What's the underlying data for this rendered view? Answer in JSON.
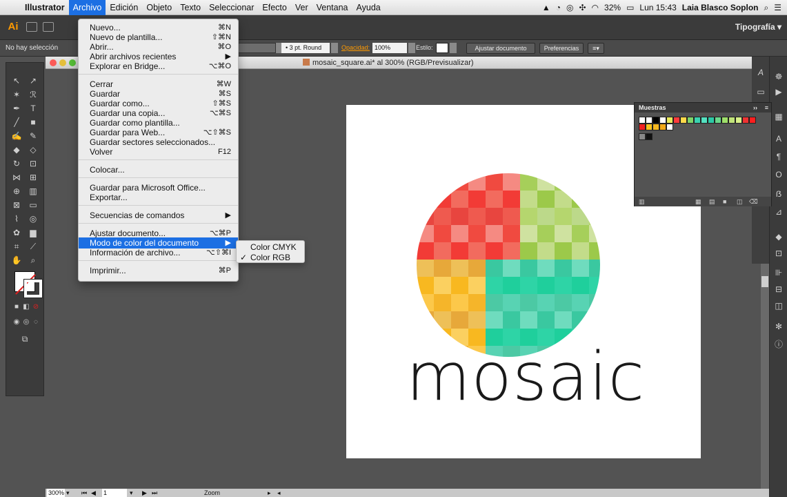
{
  "menubar": {
    "app_name": "Illustrator",
    "items": [
      "Archivo",
      "Edición",
      "Objeto",
      "Texto",
      "Seleccionar",
      "Efecto",
      "Ver",
      "Ventana",
      "Ayuda"
    ],
    "battery": "32%",
    "clock": "Lun 15:43",
    "user": "Laia Blasco Soplon"
  },
  "appbar": {
    "workspace": "Tipografía",
    "logo": "Ai"
  },
  "controlbar": {
    "selection_status": "No hay selección",
    "stroke_profile": "3 pt. Round",
    "opacity_label": "Opacidad:",
    "opacity_value": "100%",
    "style_label": "Estilo:",
    "btn_document_setup": "Ajustar documento",
    "btn_preferences": "Preferencias"
  },
  "document": {
    "title": "mosaic_square.ai* al 300% (RGB/Previsualizar)",
    "artwork_word": "mosaic",
    "zoom": "300%",
    "page": "1",
    "status_label": "Zoom"
  },
  "file_menu": {
    "items": [
      {
        "label": "Nuevo...",
        "shortcut": "⌘N"
      },
      {
        "label": "Nuevo de plantilla...",
        "shortcut": "⇧⌘N"
      },
      {
        "label": "Abrir...",
        "shortcut": "⌘O"
      },
      {
        "label": "Abrir archivos recientes",
        "shortcut": "▶"
      },
      {
        "label": "Explorar en Bridge...",
        "shortcut": "⌥⌘O"
      },
      {
        "label": "Cerrar",
        "shortcut": "⌘W"
      },
      {
        "label": "Guardar",
        "shortcut": "⌘S"
      },
      {
        "label": "Guardar como...",
        "shortcut": "⇧⌘S"
      },
      {
        "label": "Guardar una copia...",
        "shortcut": "⌥⌘S"
      },
      {
        "label": "Guardar como plantilla...",
        "shortcut": ""
      },
      {
        "label": "Guardar para Web...",
        "shortcut": "⌥⇧⌘S"
      },
      {
        "label": "Guardar sectores seleccionados...",
        "shortcut": ""
      },
      {
        "label": "Volver",
        "shortcut": "F12"
      },
      {
        "label": "Colocar...",
        "shortcut": ""
      },
      {
        "label": "Guardar para Microsoft Office...",
        "shortcut": ""
      },
      {
        "label": "Exportar...",
        "shortcut": ""
      },
      {
        "label": "Secuencias de comandos",
        "shortcut": "▶"
      },
      {
        "label": "Ajustar documento...",
        "shortcut": "⌥⌘P"
      },
      {
        "label": "Modo de color del documento",
        "shortcut": "▶"
      },
      {
        "label": "Información de archivo...",
        "shortcut": "⌥⇧⌘I"
      },
      {
        "label": "Imprimir...",
        "shortcut": "⌘P"
      }
    ]
  },
  "color_mode_submenu": {
    "items": [
      {
        "label": "Color CMYK",
        "checked": false
      },
      {
        "label": "Color RGB",
        "checked": true
      }
    ],
    "check_glyph": "✓"
  },
  "swatches_panel": {
    "title": "Muestras"
  },
  "colors": {
    "accent": "#1c6fe3",
    "ai_orange": "#ff9a00",
    "mosaic_red": "#f04a40",
    "mosaic_green": "#a6cf5a",
    "mosaic_yellow": "#f8b820",
    "mosaic_teal": "#2ed4a6"
  }
}
